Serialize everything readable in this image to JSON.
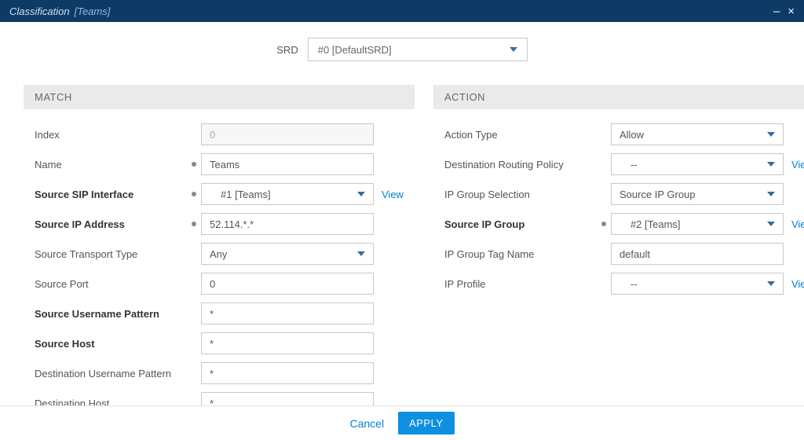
{
  "titlebar": {
    "title": "Classification",
    "subtitle": "[Teams]"
  },
  "srd": {
    "label": "SRD",
    "value": "#0 [DefaultSRD]"
  },
  "sections": {
    "match": "MATCH",
    "action": "ACTION"
  },
  "match": {
    "index": {
      "label": "Index",
      "value": "0"
    },
    "name": {
      "label": "Name",
      "value": "Teams"
    },
    "src_sip_if": {
      "label": "Source SIP Interface",
      "value": "#1 [Teams]",
      "view": "View"
    },
    "src_ip": {
      "label": "Source IP Address",
      "value": "52.114.*.*"
    },
    "src_transport": {
      "label": "Source Transport Type",
      "value": "Any"
    },
    "src_port": {
      "label": "Source Port",
      "value": "0"
    },
    "src_user_ptn": {
      "label": "Source Username Pattern",
      "value": "*"
    },
    "src_host": {
      "label": "Source Host",
      "value": "*"
    },
    "dst_user_ptn": {
      "label": "Destination Username Pattern",
      "value": "*"
    },
    "dst_host": {
      "label": "Destination Host",
      "value": "*"
    }
  },
  "action": {
    "action_type": {
      "label": "Action Type",
      "value": "Allow"
    },
    "dest_routing": {
      "label": "Destination Routing Policy",
      "value": "--",
      "view": "View"
    },
    "ipg_selection": {
      "label": "IP Group Selection",
      "value": "Source IP Group"
    },
    "src_ip_group": {
      "label": "Source IP Group",
      "value": "#2 [Teams]",
      "view": "View"
    },
    "ipg_tag": {
      "label": "IP Group Tag Name",
      "value": "default"
    },
    "ip_profile": {
      "label": "IP Profile",
      "value": "--",
      "view": "View"
    }
  },
  "footer": {
    "cancel": "Cancel",
    "apply": "APPLY"
  }
}
